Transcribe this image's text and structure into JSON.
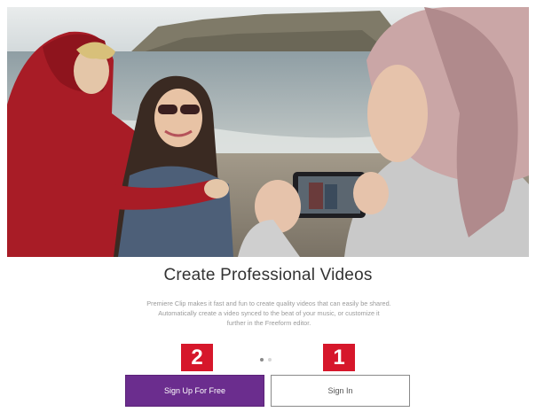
{
  "hero": {
    "image": "photo of friends on beach being filmed on phone"
  },
  "content": {
    "title": "Create Professional Videos",
    "description_line1": "Premiere Clip makes it fast and fun to create quality videos that can easily be shared.",
    "description_line2": "Automatically create a video synced to the beat of your music, or customize it",
    "description_line3": "further in the Freeform editor."
  },
  "pagination": {
    "total": 2,
    "active": 1
  },
  "annotations": {
    "badge_signup": "2",
    "badge_signin": "1"
  },
  "buttons": {
    "signup_label": "Sign Up For Free",
    "signin_label": "Sign In"
  },
  "colors": {
    "signup_bg": "#6b2d8e",
    "badge_bg": "#d6172b"
  }
}
